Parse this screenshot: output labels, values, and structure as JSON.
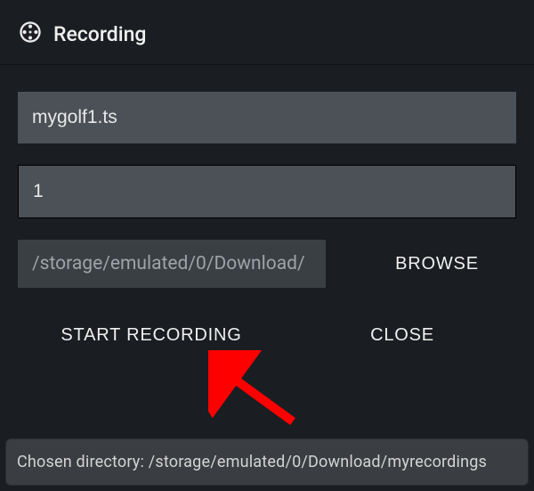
{
  "header": {
    "title": "Recording"
  },
  "inputs": {
    "filename_value": "mygolf1.ts",
    "duration_value": "1",
    "path_value": "/storage/emulated/0/Download/"
  },
  "buttons": {
    "browse": "BROWSE",
    "start": "START RECORDING",
    "close": "CLOSE"
  },
  "toast": {
    "message": "Chosen directory: /storage/emulated/0/Download/myrecordings"
  }
}
